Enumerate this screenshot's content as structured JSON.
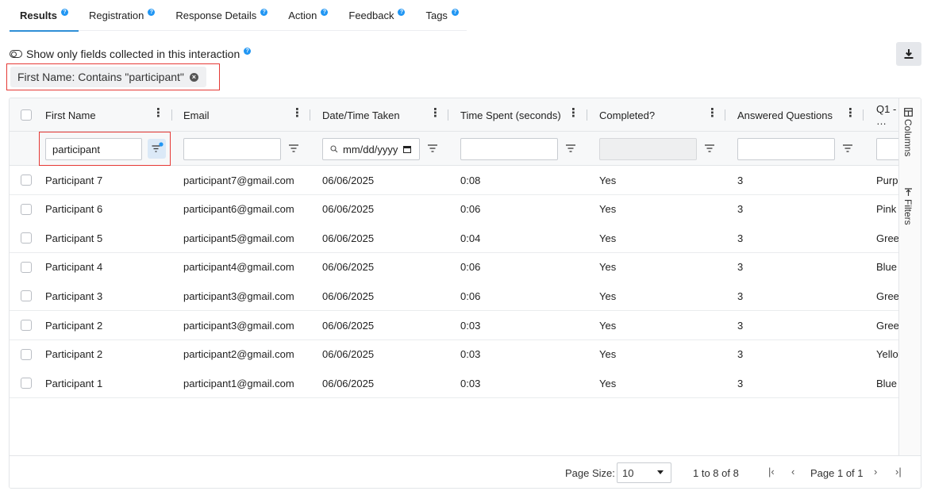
{
  "tabs": [
    {
      "label": "Results",
      "active": true
    },
    {
      "label": "Registration"
    },
    {
      "label": "Response Details"
    },
    {
      "label": "Action"
    },
    {
      "label": "Feedback"
    },
    {
      "label": "Tags"
    }
  ],
  "toolbar": {
    "toggle_label": "Show only fields collected in this interaction"
  },
  "active_filter": {
    "label": "First Name:  Contains \"participant\""
  },
  "grid": {
    "columns": [
      "First Name",
      "Email",
      "Date/Time Taken",
      "Time Spent (seconds)",
      "Completed?",
      "Answered Questions",
      "Q1 - …"
    ],
    "filters": {
      "first_name_value": "participant",
      "date_placeholder": "mm/dd/yyyy"
    },
    "rows": [
      {
        "first_name": "Participant 7",
        "email": "participant7@gmail.com",
        "date": "06/06/2025",
        "time": "0:08",
        "completed": "Yes",
        "answered": "3",
        "q1": "Purple"
      },
      {
        "first_name": "Participant 6",
        "email": "participant6@gmail.com",
        "date": "06/06/2025",
        "time": "0:06",
        "completed": "Yes",
        "answered": "3",
        "q1": "Pink"
      },
      {
        "first_name": "Participant 5",
        "email": "participant5@gmail.com",
        "date": "06/06/2025",
        "time": "0:04",
        "completed": "Yes",
        "answered": "3",
        "q1": "Green"
      },
      {
        "first_name": "Participant 4",
        "email": "participant4@gmail.com",
        "date": "06/06/2025",
        "time": "0:06",
        "completed": "Yes",
        "answered": "3",
        "q1": "Blue"
      },
      {
        "first_name": "Participant 3",
        "email": "participant3@gmail.com",
        "date": "06/06/2025",
        "time": "0:06",
        "completed": "Yes",
        "answered": "3",
        "q1": "Green"
      },
      {
        "first_name": "Participant 2",
        "email": "participant3@gmail.com",
        "date": "06/06/2025",
        "time": "0:03",
        "completed": "Yes",
        "answered": "3",
        "q1": "Green"
      },
      {
        "first_name": "Participant 2",
        "email": "participant2@gmail.com",
        "date": "06/06/2025",
        "time": "0:03",
        "completed": "Yes",
        "answered": "3",
        "q1": "Yellow"
      },
      {
        "first_name": "Participant 1",
        "email": "participant1@gmail.com",
        "date": "06/06/2025",
        "time": "0:03",
        "completed": "Yes",
        "answered": "3",
        "q1": "Blue"
      }
    ],
    "side_tabs": {
      "columns": "Columns",
      "filters": "Filters"
    }
  },
  "pagination": {
    "page_size_label": "Page Size:",
    "page_size_value": "10",
    "range_text": "1 to 8 of 8",
    "page_text": "Page 1 of 1"
  },
  "colors": {
    "accent": "#2196f3",
    "highlight": "#e53935"
  }
}
